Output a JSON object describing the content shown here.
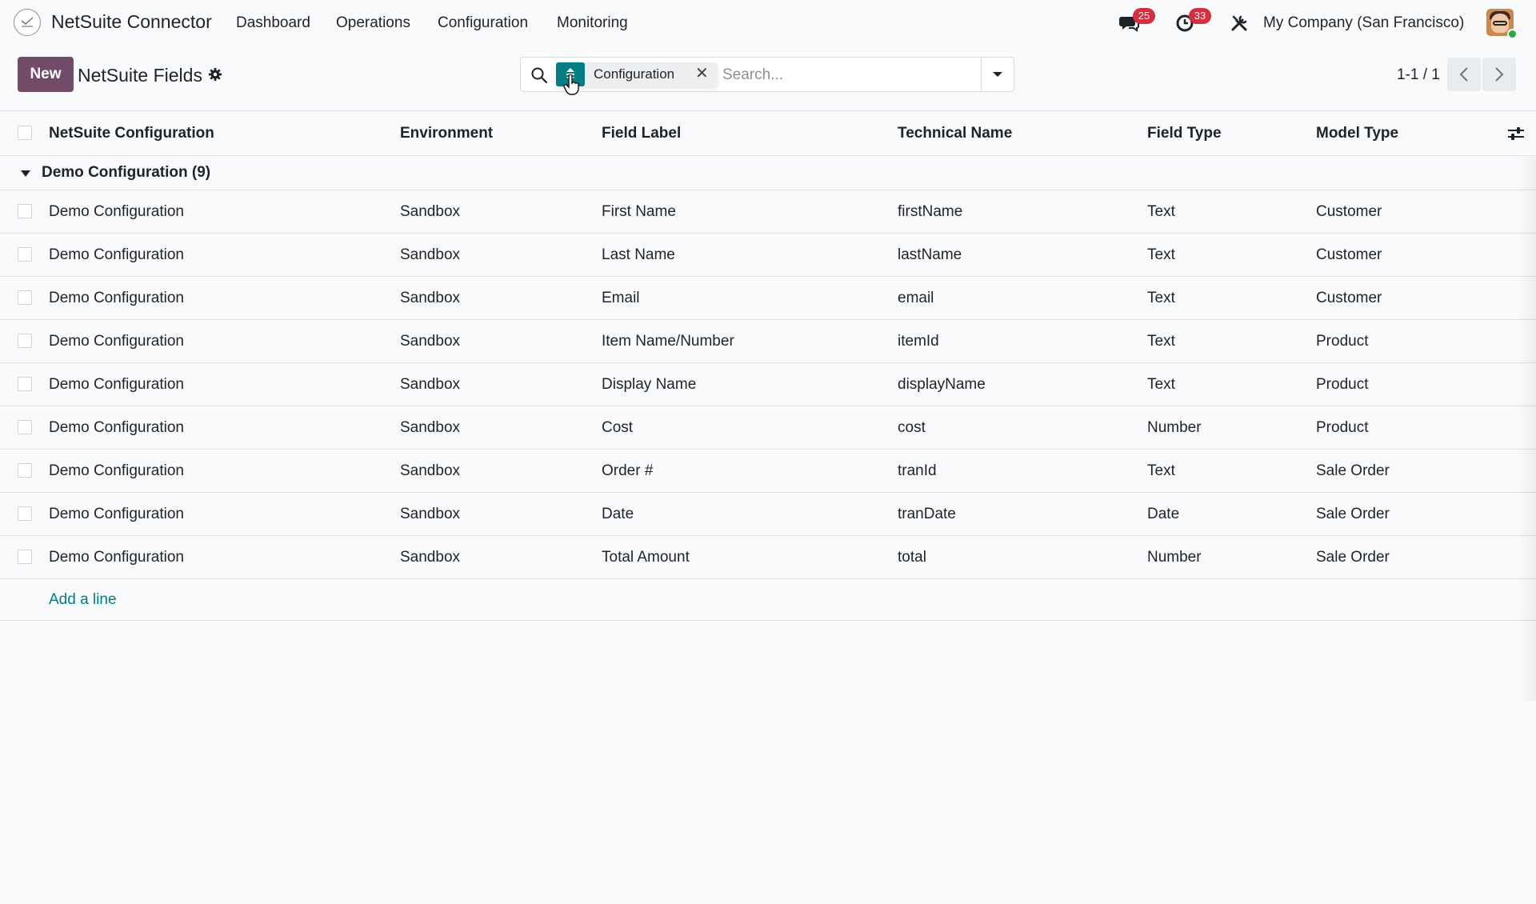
{
  "navbar": {
    "app_name": "NetSuite Connector",
    "menu": [
      "Dashboard",
      "Operations",
      "Configuration",
      "Monitoring"
    ],
    "messages_badge": "25",
    "activities_badge": "33",
    "company": "My Company (San Francisco)"
  },
  "control": {
    "new_label": "New",
    "title": "NetSuite Fields",
    "facet_label": "Configuration",
    "facet_remove": "✕",
    "search_placeholder": "Search...",
    "pager": "1-1 / 1"
  },
  "table": {
    "headers": [
      "NetSuite Configuration",
      "Environment",
      "Field Label",
      "Technical Name",
      "Field Type",
      "Model Type"
    ],
    "group_label": "Demo Configuration (9)",
    "rows": [
      [
        "Demo Configuration",
        "Sandbox",
        "First Name",
        "firstName",
        "Text",
        "Customer"
      ],
      [
        "Demo Configuration",
        "Sandbox",
        "Last Name",
        "lastName",
        "Text",
        "Customer"
      ],
      [
        "Demo Configuration",
        "Sandbox",
        "Email",
        "email",
        "Text",
        "Customer"
      ],
      [
        "Demo Configuration",
        "Sandbox",
        "Item Name/Number",
        "itemId",
        "Text",
        "Product"
      ],
      [
        "Demo Configuration",
        "Sandbox",
        "Display Name",
        "displayName",
        "Text",
        "Product"
      ],
      [
        "Demo Configuration",
        "Sandbox",
        "Cost",
        "cost",
        "Number",
        "Product"
      ],
      [
        "Demo Configuration",
        "Sandbox",
        "Order #",
        "tranId",
        "Text",
        "Sale Order"
      ],
      [
        "Demo Configuration",
        "Sandbox",
        "Date",
        "tranDate",
        "Date",
        "Sale Order"
      ],
      [
        "Demo Configuration",
        "Sandbox",
        "Total Amount",
        "total",
        "Number",
        "Sale Order"
      ]
    ],
    "add_line": "Add a line"
  },
  "colors": {
    "brand": "#714b67",
    "accent": "#017e84",
    "badge": "#d32f3f"
  }
}
